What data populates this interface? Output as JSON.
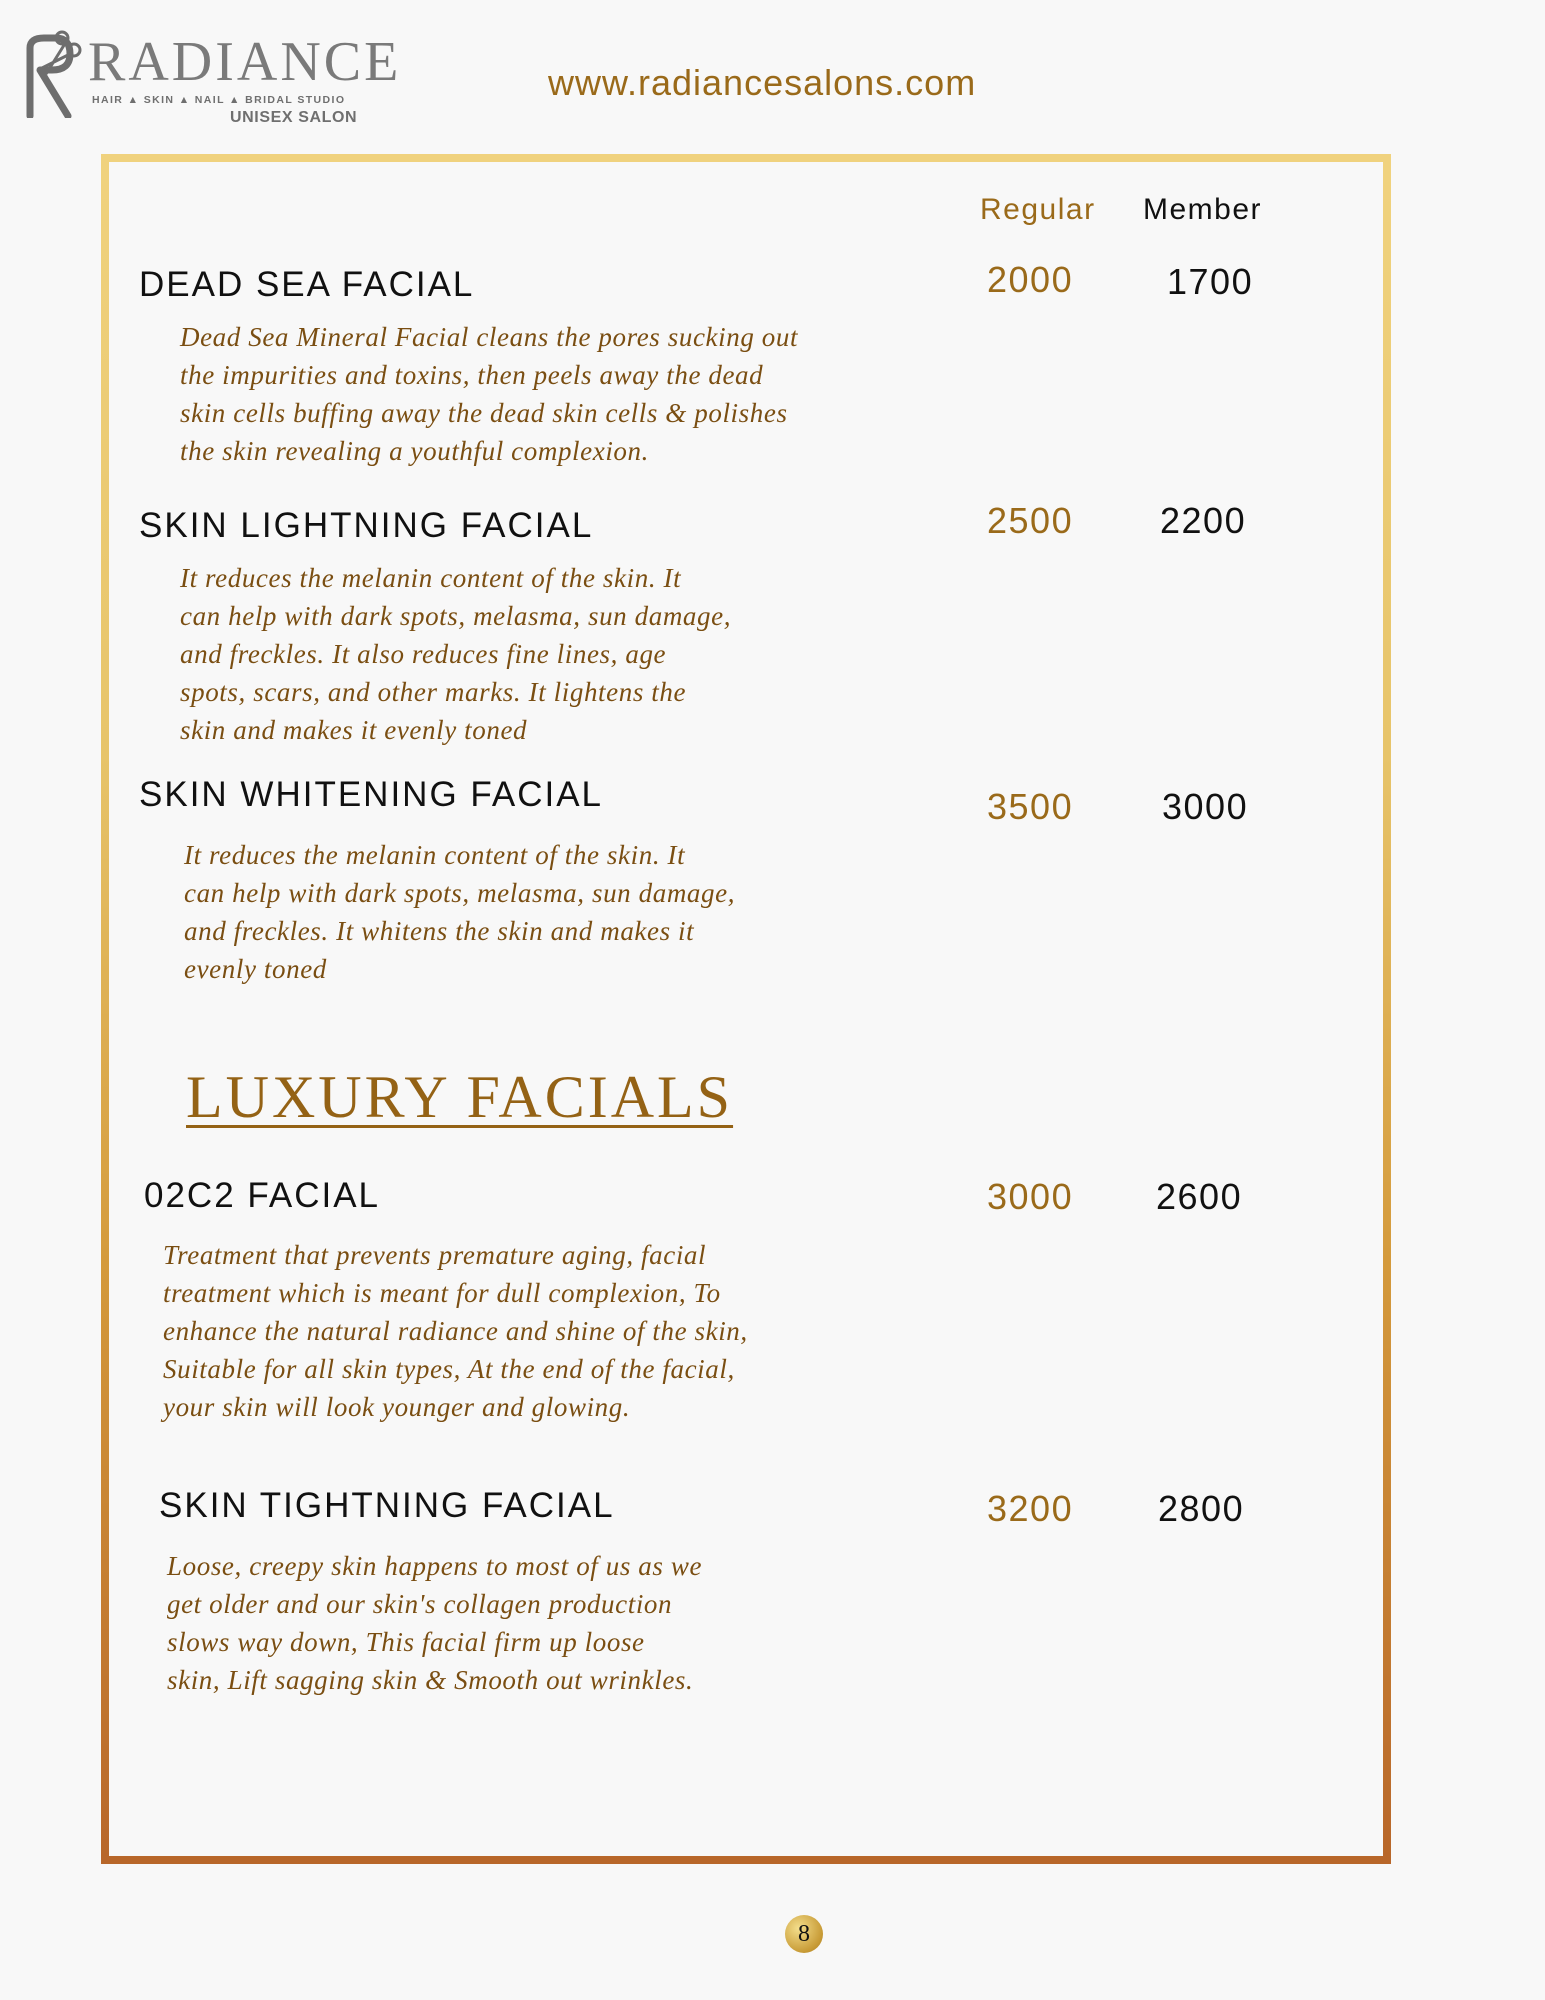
{
  "header": {
    "logo_text": "RADIANCE",
    "logo_tagline": "HAIR ▲ SKIN ▲ NAIL ▲ BRIDAL STUDIO",
    "logo_subtitle": "UNISEX SALON",
    "website": "www.radiancesalons.com"
  },
  "columns": {
    "regular": "Regular",
    "member": "Member"
  },
  "services": [
    {
      "name": "DEAD SEA FACIAL",
      "description": "Dead Sea Mineral Facial cleans the pores sucking out\nthe impurities and toxins, then peels away the dead\nskin cells buffing away the dead skin cells & polishes\nthe skin revealing a youthful complexion.",
      "regular": "2000",
      "member": "1700"
    },
    {
      "name": "SKIN LIGHTNING FACIAL",
      "description": "It reduces the melanin content of the skin. It\ncan help with dark spots, melasma, sun damage,\nand freckles. It also reduces fine lines, age\nspots, scars, and other marks. It lightens the\nskin and makes it evenly toned",
      "regular": "2500",
      "member": "2200"
    },
    {
      "name": "SKIN WHITENING FACIAL",
      "description": "It reduces the melanin content of the skin. It\ncan help with dark spots, melasma, sun damage,\nand freckles. It whitens the skin and makes it\nevenly toned",
      "regular": "3500",
      "member": "3000"
    }
  ],
  "luxury_section": {
    "title": "LUXURY FACIALS",
    "services": [
      {
        "name": "02C2 FACIAL",
        "description": "Treatment that prevents premature aging, facial\ntreatment which is meant for dull complexion, To\nenhance the natural radiance and shine of the skin,\nSuitable for all skin types, At the end of the facial,\nyour skin will look younger and glowing.",
        "regular": "3000",
        "member": "2600"
      },
      {
        "name": "SKIN TIGHTNING FACIAL",
        "description": "Loose, creepy skin happens to most of us as we\nget older and our skin's collagen production\nslows way down, This facial firm up loose\nskin, Lift sagging skin & Smooth out wrinkles.",
        "regular": "3200",
        "member": "2800"
      }
    ]
  },
  "page_number": "8",
  "colors": {
    "accent_gold": "#9a6a1a",
    "description_brown": "#7a4e12",
    "frame_gold": "#e7c46a",
    "frame_copper": "#b8672a"
  },
  "icons": {
    "logo_mark": "scissors-r-logo-icon"
  }
}
